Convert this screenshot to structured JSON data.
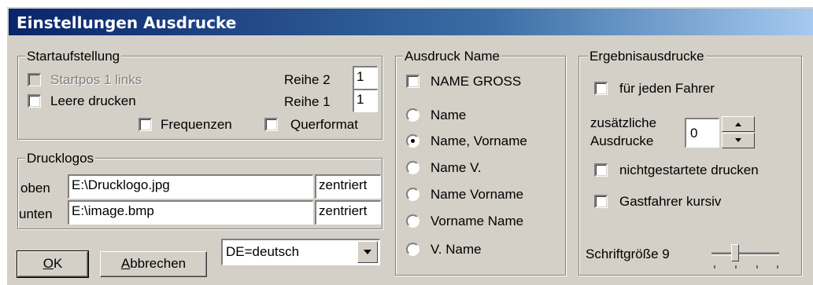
{
  "window": {
    "title": "Einstellungen Ausdrucke"
  },
  "startaufstellung": {
    "legend": "Startaufstellung",
    "startpos_label": "Startpos 1 links",
    "leere_label": "Leere drucken",
    "reihe2_label": "Reihe 2",
    "reihe2_value": "1",
    "reihe1_label": "Reihe 1",
    "reihe1_value": "1",
    "frequenzen_label": "Frequenzen",
    "querformat_label": "Querformat"
  },
  "drucklogos": {
    "legend": "Drucklogos",
    "oben_label": "oben",
    "oben_path": "E:\\Drucklogo.jpg",
    "oben_align": "zentriert",
    "unten_label": "unten",
    "unten_path": "E:\\image.bmp",
    "unten_align": "zentriert"
  },
  "buttons": {
    "ok_accel": "O",
    "ok_rest": "K",
    "cancel_accel": "A",
    "cancel_rest": "bbrechen"
  },
  "language": {
    "selected": "DE=deutsch"
  },
  "ausdruck_name": {
    "legend": "Ausdruck Name",
    "name_gross_label": "NAME GROSS",
    "options": [
      "Name",
      "Name, Vorname",
      "Name V.",
      "Name Vorname",
      "Vorname Name",
      "V. Name"
    ],
    "selected_index": 1
  },
  "ergebnis": {
    "legend": "Ergebnisausdrucke",
    "jeden_fahrer_label": "für jeden Fahrer",
    "zusaetzliche_line1": "zusätzliche",
    "zusaetzliche_line2": "Ausdrucke",
    "zusaetzliche_value": "0",
    "nichtgestartete_label": "nichtgestartete drucken",
    "gastfahrer_label": "Gastfahrer kursiv",
    "schriftgroesse_label": "Schriftgröße 9",
    "schriftgroesse_level": 0.33
  }
}
